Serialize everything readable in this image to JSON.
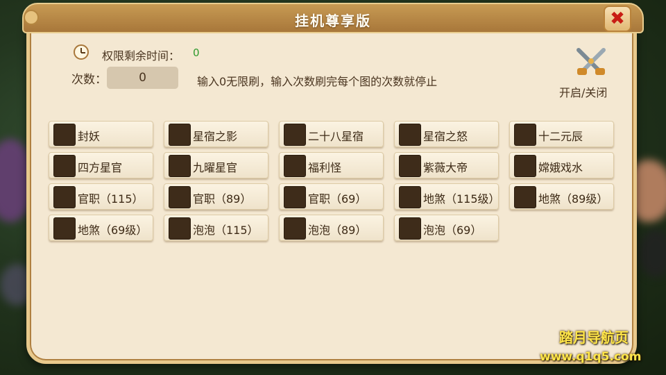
{
  "window": {
    "title": "挂机尊享版",
    "close_label": "✖"
  },
  "permission": {
    "label": "权限剩余时间：",
    "value": "0"
  },
  "count": {
    "label": "次数：",
    "value": "0",
    "hint": "输入0无限刷，输入次数刷完每个图的次数就停止"
  },
  "toggle": {
    "label": "开启/关闭",
    "icon": "crossed-swords-icon"
  },
  "options": [
    [
      "封妖",
      "星宿之影",
      "二十八星宿",
      "星宿之怒",
      "十二元辰"
    ],
    [
      "四方星官",
      "九曜星官",
      "福利怪",
      "紫薇大帝",
      "嫦娥戏水"
    ],
    [
      "官职（115）",
      "官职（89）",
      "官职（69）",
      "地煞（115级）",
      "地煞（89级）"
    ],
    [
      "地煞（69级）",
      "泡泡（115）",
      "泡泡（89）",
      "泡泡（69）"
    ]
  ],
  "watermark": {
    "line1": "踏月导航页",
    "line2": "www.q1q5.com"
  },
  "colors": {
    "panel": "#f4e8d2",
    "title_bar": "#a8773a",
    "checkbox": "#3e2c1a",
    "value_green": "#2e9a2e",
    "close_red": "#c81d14"
  }
}
